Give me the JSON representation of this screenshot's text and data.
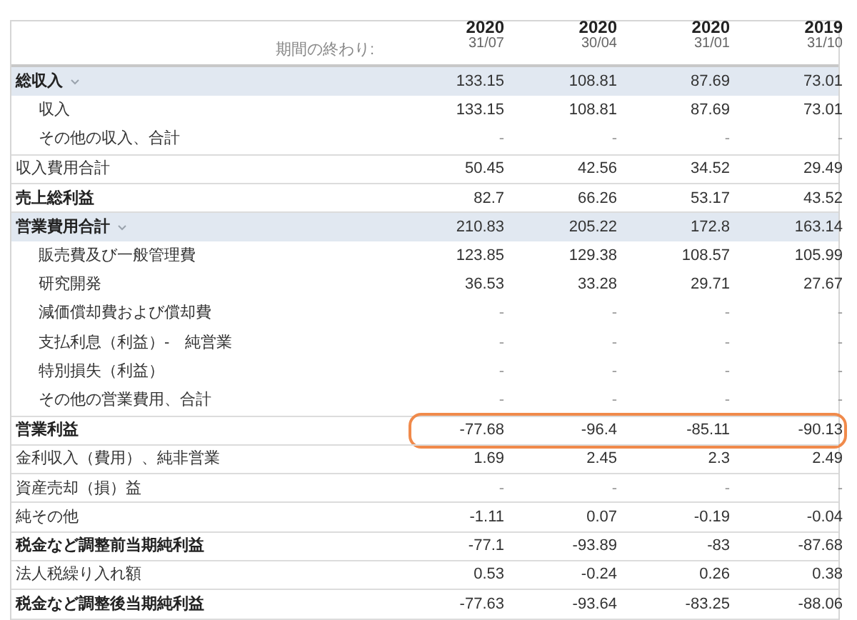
{
  "header": {
    "label": "期間の終わり:",
    "columns": [
      {
        "year": "2020",
        "date": "31/07"
      },
      {
        "year": "2020",
        "date": "30/04"
      },
      {
        "year": "2020",
        "date": "31/01"
      },
      {
        "year": "2019",
        "date": "31/10"
      }
    ]
  },
  "rows": [
    {
      "kind": "section",
      "label": "総収入",
      "expanded": true,
      "values": [
        "133.15",
        "108.81",
        "87.69",
        "73.01"
      ],
      "children": [
        {
          "label": "収入",
          "values": [
            "133.15",
            "108.81",
            "87.69",
            "73.01"
          ]
        },
        {
          "label": "その他の収入、合計",
          "values": [
            "-",
            "-",
            "-",
            "-"
          ]
        }
      ]
    },
    {
      "kind": "plain",
      "label": "収入費用合計",
      "values": [
        "50.45",
        "42.56",
        "34.52",
        "29.49"
      ]
    },
    {
      "kind": "bold",
      "label": "売上総利益",
      "values": [
        "82.7",
        "66.26",
        "53.17",
        "43.52"
      ]
    },
    {
      "kind": "section",
      "label": "営業費用合計",
      "expanded": true,
      "values": [
        "210.83",
        "205.22",
        "172.8",
        "163.14"
      ],
      "children": [
        {
          "label": "販売費及び一般管理費",
          "values": [
            "123.85",
            "129.38",
            "108.57",
            "105.99"
          ]
        },
        {
          "label": "研究開発",
          "values": [
            "36.53",
            "33.28",
            "29.71",
            "27.67"
          ]
        },
        {
          "label": "減価償却費および償却費",
          "values": [
            "-",
            "-",
            "-",
            "-"
          ]
        },
        {
          "label": "支払利息（利益）-　純営業",
          "values": [
            "-",
            "-",
            "-",
            "-"
          ]
        },
        {
          "label": "特別損失（利益）",
          "values": [
            "-",
            "-",
            "-",
            "-"
          ]
        },
        {
          "label": "その他の営業費用、合計",
          "values": [
            "-",
            "-",
            "-",
            "-"
          ]
        }
      ]
    },
    {
      "kind": "bold",
      "label": "営業利益",
      "highlighted": true,
      "values": [
        "-77.68",
        "-96.4",
        "-85.11",
        "-90.13"
      ]
    },
    {
      "kind": "plain",
      "label": "金利収入（費用）、純非営業",
      "values": [
        "1.69",
        "2.45",
        "2.3",
        "2.49"
      ]
    },
    {
      "kind": "plain",
      "label": "資産売却（損）益",
      "values": [
        "-",
        "-",
        "-",
        "-"
      ]
    },
    {
      "kind": "plain",
      "label": "純その他",
      "values": [
        "-1.11",
        "0.07",
        "-0.19",
        "-0.04"
      ]
    },
    {
      "kind": "bold",
      "label": "税金など調整前当期純利益",
      "values": [
        "-77.1",
        "-93.89",
        "-83",
        "-87.68"
      ]
    },
    {
      "kind": "plain",
      "label": "法人税繰り入れ額",
      "values": [
        "0.53",
        "-0.24",
        "0.26",
        "0.38"
      ]
    },
    {
      "kind": "bold",
      "label": "税金など調整後当期純利益",
      "values": [
        "-77.63",
        "-93.64",
        "-83.25",
        "-88.06"
      ]
    }
  ]
}
